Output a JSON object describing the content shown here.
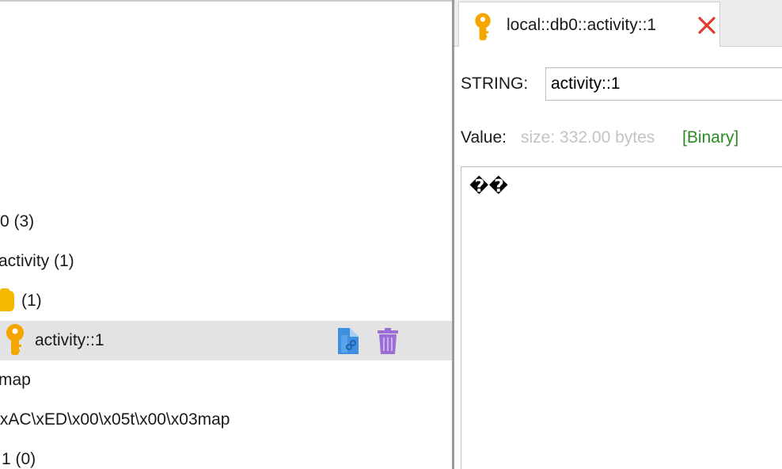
{
  "tree": {
    "rows": [
      {
        "label": "0  (3)"
      },
      {
        "label": "activity (1)"
      },
      {
        "label": "(1)"
      },
      {
        "label": "activity::1"
      },
      {
        "label": "map"
      },
      {
        "label": "\\xAC\\xED\\x00\\x05t\\x00\\x03map"
      },
      {
        "label": "1  (0)"
      }
    ],
    "selected_index": 3,
    "icons": {
      "folder": "folder-icon",
      "key": "key-icon",
      "copy_link": "document-link-icon",
      "delete": "trash-icon"
    },
    "colors": {
      "selected_row": "#e3e3e3",
      "folder": "#f7b900",
      "key": "#f5a500",
      "trash": "#9b6fd6",
      "doc": "#3f8fe0"
    }
  },
  "detail": {
    "tab": {
      "title": "local::db0::activity::1",
      "icon": "key-icon",
      "close_icon": "close-icon"
    },
    "key_type_label": "STRING:",
    "key_value": "activity::1",
    "value_label": "Value:",
    "value_size": "size: 332.00 bytes",
    "value_format": "[Binary]",
    "value_content": "��",
    "colors": {
      "close": "#e23a2e",
      "binary": "#2b8a1f",
      "size_text": "#c3c3c3"
    }
  }
}
